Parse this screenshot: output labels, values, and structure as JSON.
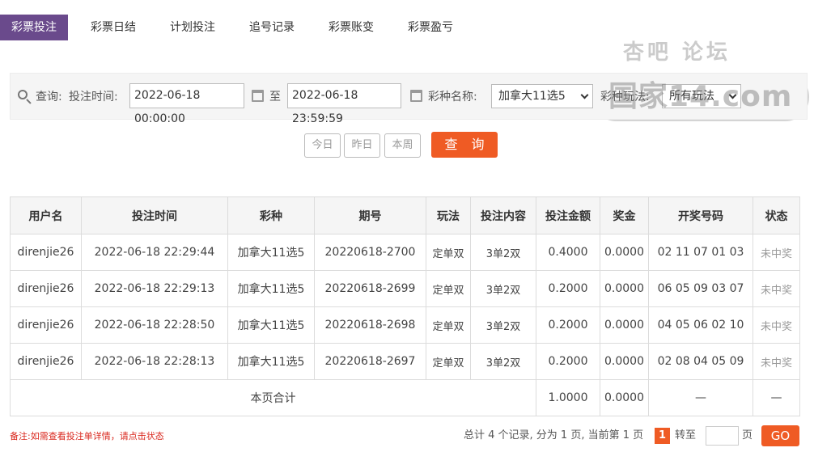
{
  "tabs": [
    {
      "label": "彩票投注",
      "active": true
    },
    {
      "label": "彩票日结",
      "active": false
    },
    {
      "label": "计划投注",
      "active": false
    },
    {
      "label": "追号记录",
      "active": false
    },
    {
      "label": "彩票账变",
      "active": false
    },
    {
      "label": "彩票盈亏",
      "active": false
    }
  ],
  "filter": {
    "query_label": "查询:",
    "time_label": "投注时间:",
    "start_time": "2022-06-18 00:00:00",
    "to_label": "至",
    "end_time": "2022-06-18 23:59:59",
    "lottery_label": "彩种名称:",
    "lottery_value": "加拿大11选5",
    "play_label": "彩种玩法:",
    "play_value": "所有玩法"
  },
  "quick_buttons": {
    "today": "今日",
    "yesterday": "昨日",
    "week": "本周",
    "query": "查 询"
  },
  "table": {
    "headers": [
      "用户名",
      "投注时间",
      "彩种",
      "期号",
      "玩法",
      "投注内容",
      "投注金额",
      "奖金",
      "开奖号码",
      "状态"
    ],
    "rows": [
      [
        "direnjie26",
        "2022-06-18 22:29:44",
        "加拿大11选5",
        "20220618-2700",
        "定单双",
        "3单2双",
        "0.4000",
        "0.0000",
        "02 11 07 01 03",
        "未中奖"
      ],
      [
        "direnjie26",
        "2022-06-18 22:29:13",
        "加拿大11选5",
        "20220618-2699",
        "定单双",
        "3单2双",
        "0.2000",
        "0.0000",
        "06 05 09 03 07",
        "未中奖"
      ],
      [
        "direnjie26",
        "2022-06-18 22:28:50",
        "加拿大11选5",
        "20220618-2698",
        "定单双",
        "3单2双",
        "0.2000",
        "0.0000",
        "04 05 06 02 10",
        "未中奖"
      ],
      [
        "direnjie26",
        "2022-06-18 22:28:13",
        "加拿大11选5",
        "20220618-2697",
        "定单双",
        "3单2双",
        "0.2000",
        "0.0000",
        "02 08 04 05 09",
        "未中奖"
      ]
    ],
    "total": {
      "label": "本页合计",
      "amount": "1.0000",
      "bonus": "0.0000",
      "numbers": "—",
      "status": "—"
    }
  },
  "footer": {
    "note": "备注:如需查看投注单详情，请点击状态",
    "summary": "总计 4 个记录, 分为 1 页, 当前第 1 页",
    "current_page": "1",
    "goto_label": "转至",
    "page_unit": "页",
    "go_label": "GO"
  },
  "watermark": {
    "line1": "杏吧 论坛",
    "line2": "国家14.com"
  },
  "colors": {
    "tab_active": "#6a4a8c",
    "accent": "#ef5b24",
    "note": "#d9261c"
  }
}
